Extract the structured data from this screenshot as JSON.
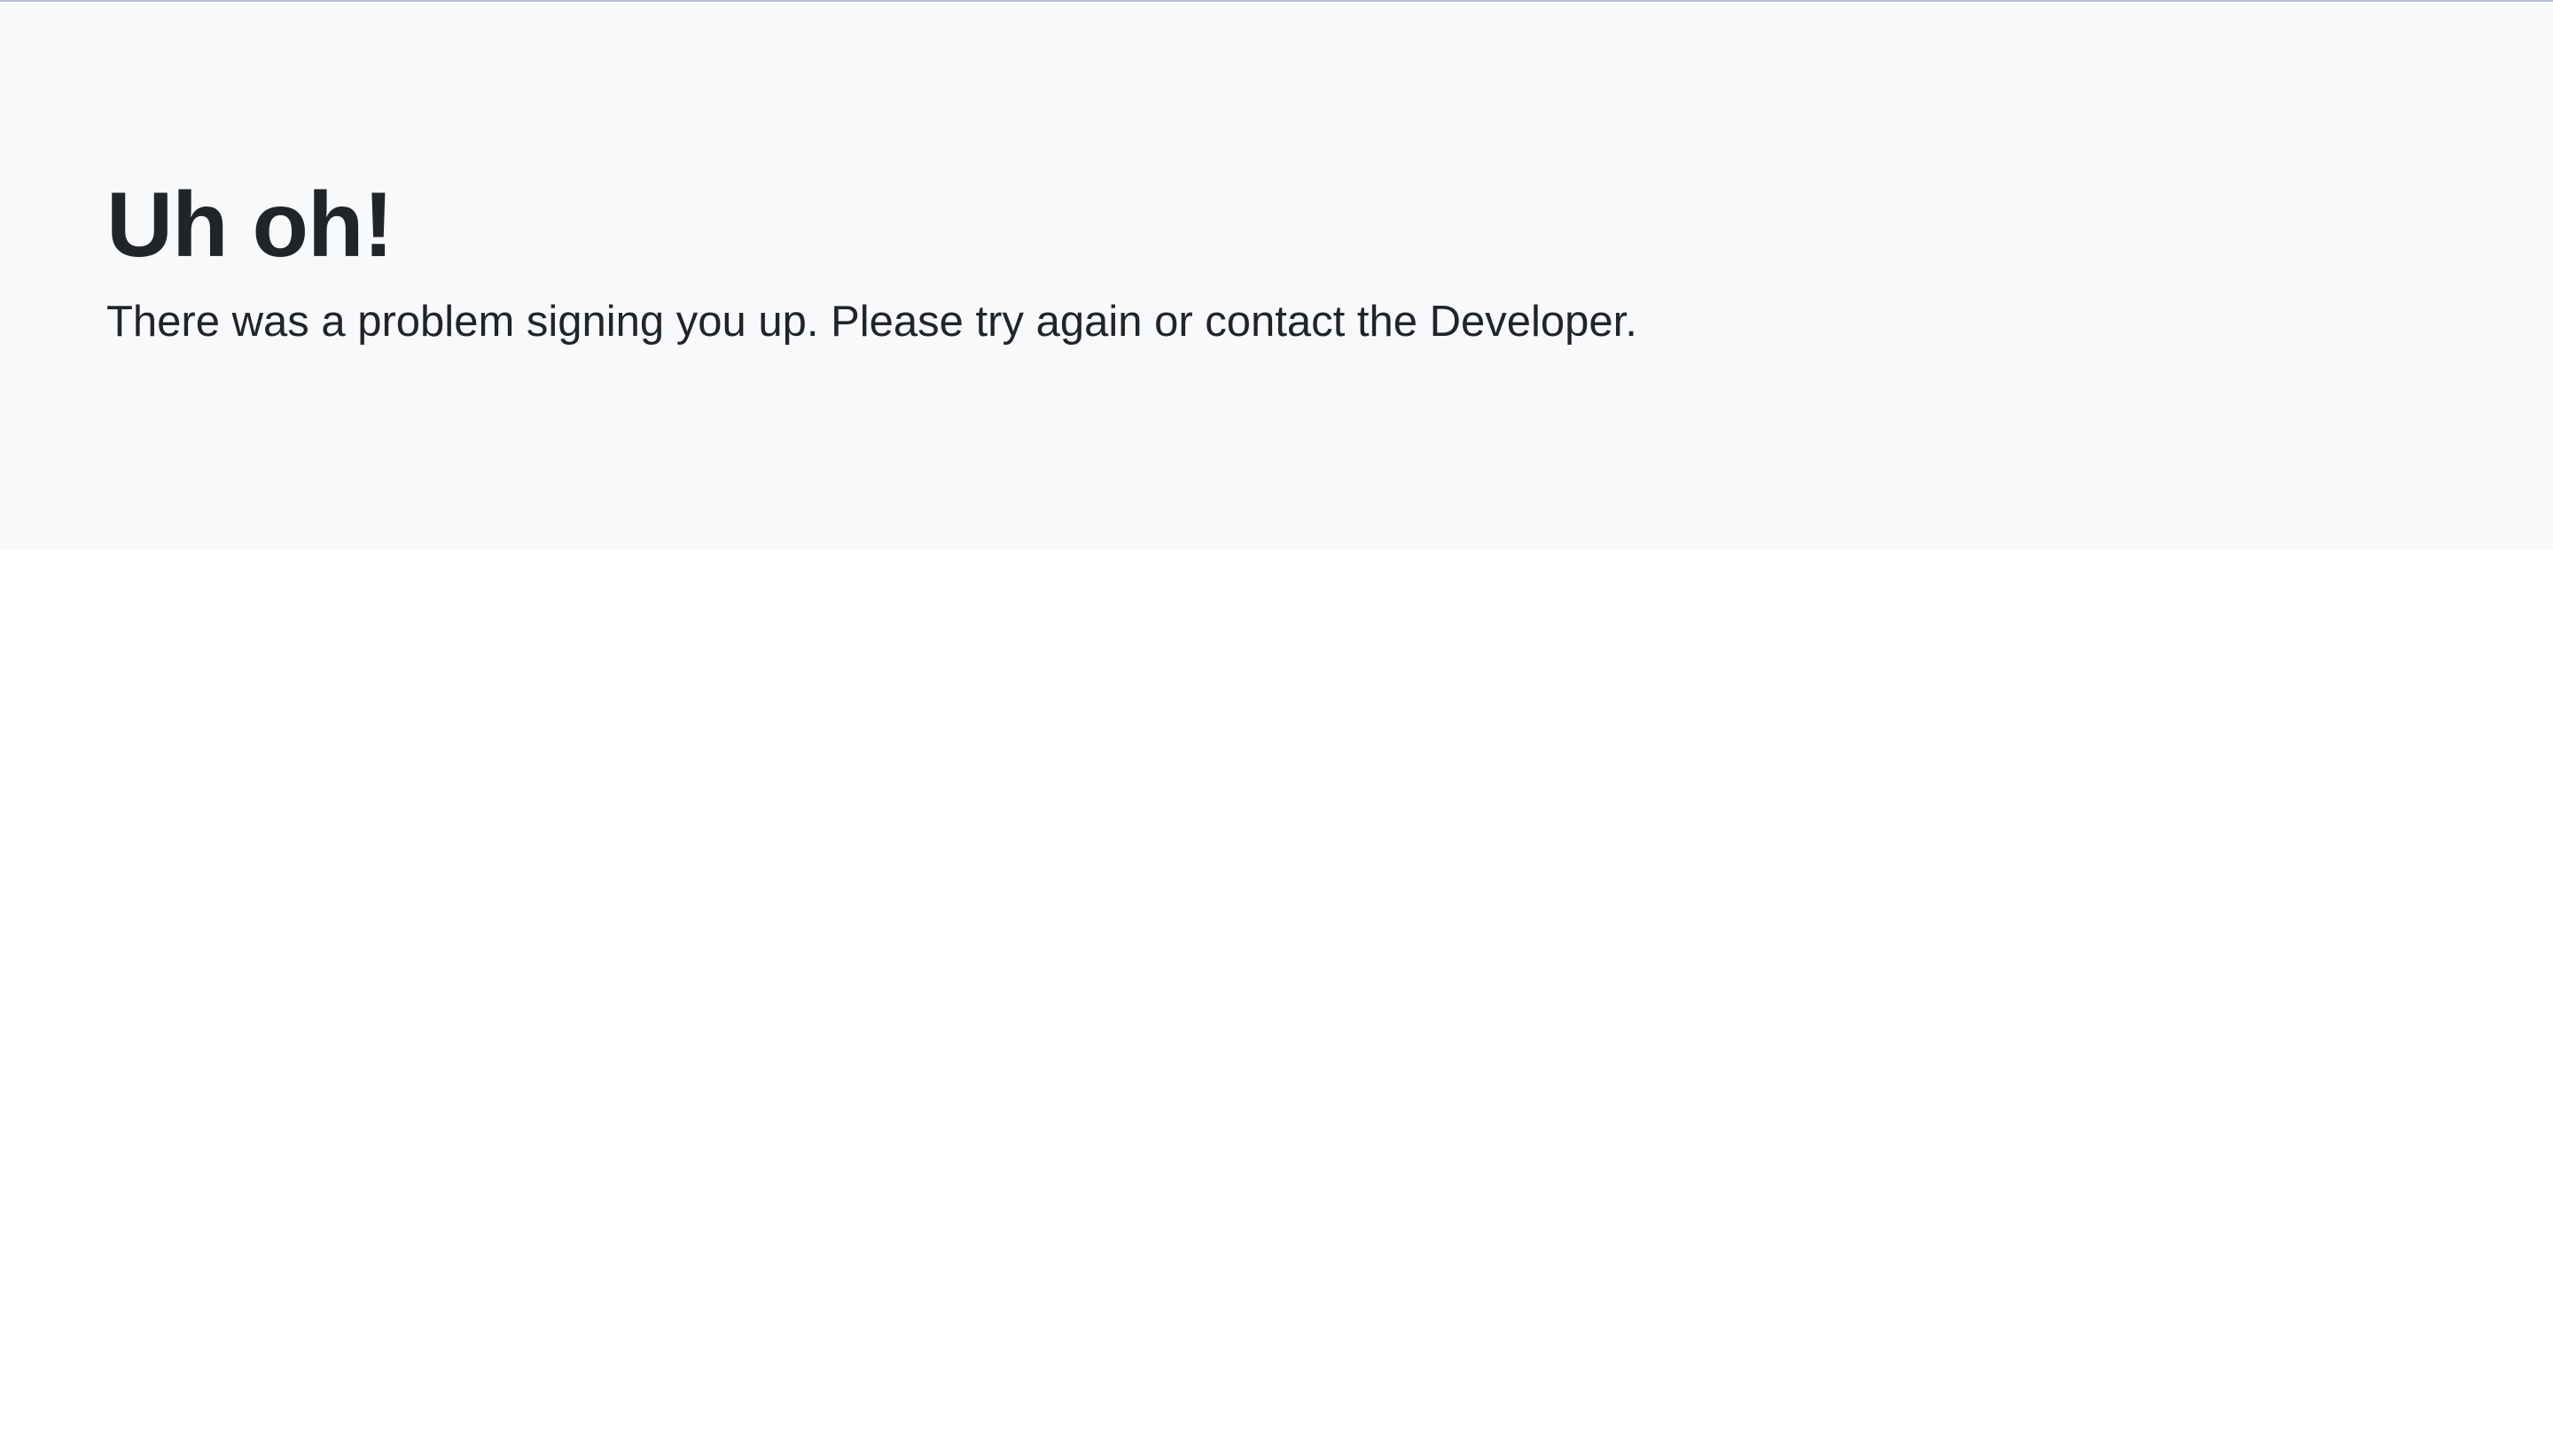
{
  "hero": {
    "title": "Uh oh!",
    "message": "There was a problem signing you up. Please try again or contact the Developer."
  },
  "colors": {
    "hero_background": "#f8f9fa",
    "text": "#212529",
    "page_background": "#ffffff",
    "top_rule": "#b9bfd6"
  }
}
